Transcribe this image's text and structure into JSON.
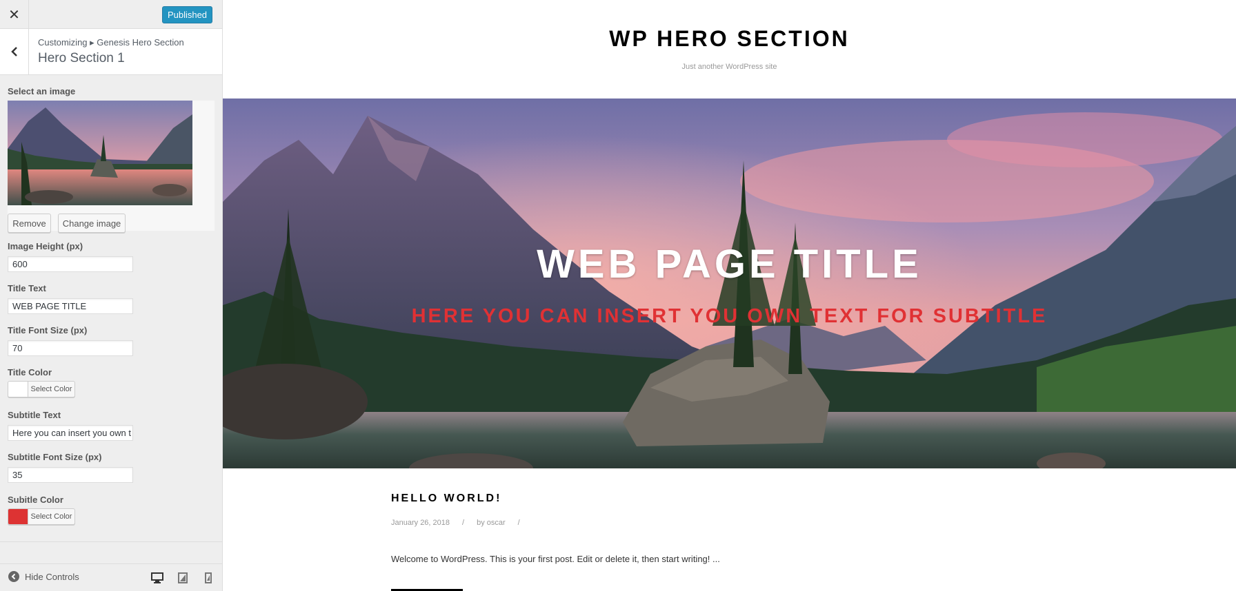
{
  "customizer": {
    "close_icon": "close-icon",
    "publish_label": "Published",
    "breadcrumb": "Customizing ▸ Genesis Hero Section",
    "section_title": "Hero Section 1",
    "image": {
      "label": "Select an image",
      "remove_label": "Remove",
      "change_label": "Change image"
    },
    "image_height": {
      "label": "Image Height (px)",
      "value": "600"
    },
    "title_text": {
      "label": "Title Text",
      "value": "WEB PAGE TITLE"
    },
    "title_font_size": {
      "label": "Title Font Size (px)",
      "value": "70"
    },
    "title_color": {
      "label": "Title Color",
      "button_label": "Select Color",
      "color": "#ffffff"
    },
    "subtitle_text": {
      "label": "Subtitle Text",
      "value": "Here you can insert you own t"
    },
    "subtitle_font_size": {
      "label": "Subtitle Font Size (px)",
      "value": "35"
    },
    "subtitle_color": {
      "label": "Subitle Color",
      "button_label": "Select Color",
      "color": "#dd3333"
    },
    "footer": {
      "hide_controls_label": "Hide Controls",
      "devices": [
        "desktop-icon",
        "tablet-icon",
        "mobile-icon"
      ]
    }
  },
  "preview": {
    "site_title": "WP HERO SECTION",
    "site_description": "Just another WordPress site",
    "hero_title": "WEB PAGE TITLE",
    "hero_subtitle": "HERE YOU CAN INSERT YOU OWN TEXT FOR SUBTITLE",
    "post": {
      "title": "HELLO WORLD!",
      "date": "January 26, 2018",
      "sep1": "/",
      "author": "by oscar",
      "sep2": "/",
      "excerpt": "Welcome to WordPress. This is your first post. Edit or delete it, then start writing! ..."
    }
  },
  "colors": {
    "publish_button": "#0085ba",
    "subtitle": "#e03134"
  }
}
